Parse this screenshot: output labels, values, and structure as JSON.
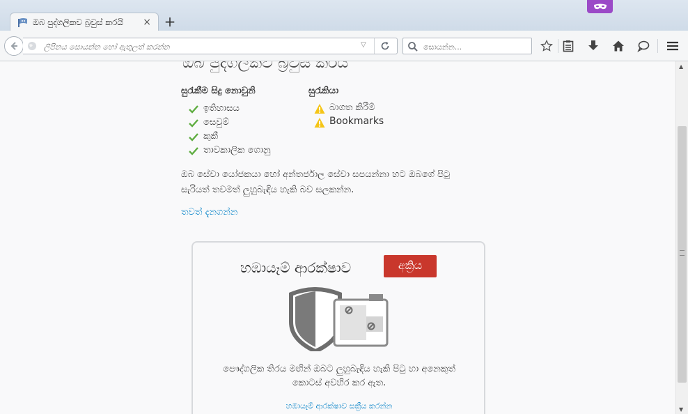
{
  "window": {
    "tab_title": "ඔබ පුද්ගලිකව බ්‍රවුස් කරයි",
    "tab_close": "×",
    "new_tab": "+"
  },
  "navbar": {
    "url_placeholder": "ලිපිනය සොයන්න හෝ ඇතුලත් කරන්න",
    "search_placeholder": "සොයන්න...",
    "url_dropdown_icon": "▽"
  },
  "page": {
    "heading": "ඔබ පුද්ගලිකව බ්‍රවුස් කරයි",
    "not_saved_heading": "සුරැකීම සිදු නොවුනි",
    "not_saved_items": [
      "ඉතිහාසය",
      "සෙවුම්",
      "කුකී",
      "තාවකාලික ගොනු"
    ],
    "saved_heading": "සුරැකියා",
    "saved_items": [
      "බාගත කිරීම්",
      "Bookmarks"
    ],
    "paragraph": "ඔබ සේවා යෝජකයා හෝ අන්තර්ජාල සේවා සපයන්නා හට ඔබගේ පිටු සැරියත් තවමත් ලුහුබැඳිය හැකි බව සලකන්න.",
    "learn_more": "තවත් දැනගන්න",
    "tracking": {
      "title": "හඹායෑම් ආරක්ෂාව",
      "status_button": "අක්‍රිය",
      "description": "පෞද්ගලික තිරය මඟින් ඔබට ලුහුබැඳිය හැකි පිටු හා අනෙකුත් කොටස් අවහිර කර ඇත.",
      "enable_link": "හඹායෑම් ආරක්ෂාව සක්‍රීය කරන්න"
    }
  },
  "colors": {
    "accent_link": "#0a84c8",
    "status_off": "#c9372c",
    "check_green": "#5fad41",
    "warning_yellow": "#f5c517",
    "private_purple": "#9b4ac7"
  },
  "icons": {
    "not_saved": "check-icon",
    "saved": "warning-icon"
  }
}
